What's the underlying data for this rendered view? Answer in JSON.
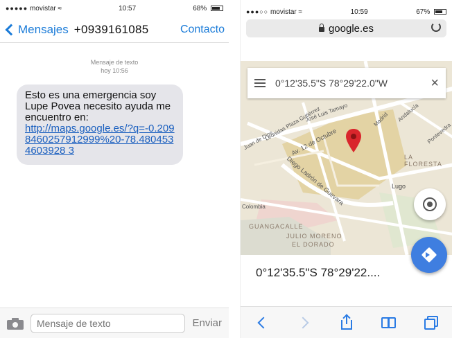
{
  "messages_screen": {
    "status": {
      "carrier": "movistar",
      "signal": "●●●●●",
      "time": "10:57",
      "battery": "68%"
    },
    "nav": {
      "back_label": "Mensajes",
      "contact": "+0939161085",
      "contact_button": "Contacto"
    },
    "meta": {
      "line1": "Mensaje de texto",
      "line2": "hoy 10:56"
    },
    "message": {
      "text": "Esto es una emergencia soy Lupe Povea necesito ayuda me encuentro en:",
      "link": "http://maps.google.es/?q=-0.2098460257912999%20-78.4804534603928 3"
    },
    "input": {
      "placeholder": "Mensaje de texto",
      "send_label": "Enviar"
    }
  },
  "browser_screen": {
    "status": {
      "carrier": "movistar",
      "signal": "●●●○○",
      "time": "10:59",
      "battery": "67%"
    },
    "url": "google.es",
    "search_query": "0°12'35.5\"S 78°29'22.0\"W",
    "clear_symbol": "×",
    "place_title": "0°12'35.5\"S 78°29'22....",
    "map_labels": {
      "street1": "Juan de Dios",
      "street2": "Leonidas Plaza Gutiérrez",
      "street3": "José Luis Tamayo",
      "street4": "Av. 12 de Octubre",
      "street5": "Madrid",
      "street6": "Andalucía",
      "street7": "Diego Ladrón de Guevara",
      "area1": "LA FLORESTA",
      "area2": "GUANGACALLE",
      "area3": "JULIO MORENO",
      "area4": "EL DORADO",
      "area5": "Lugo",
      "street8": "Colombia",
      "street9": "Pontevedra"
    }
  },
  "colors": {
    "ios_blue": "#1a7bd8",
    "bubble_gray": "#e5e5ea",
    "pin_red": "#d9262c",
    "fab_blue": "#3f7ee0"
  }
}
